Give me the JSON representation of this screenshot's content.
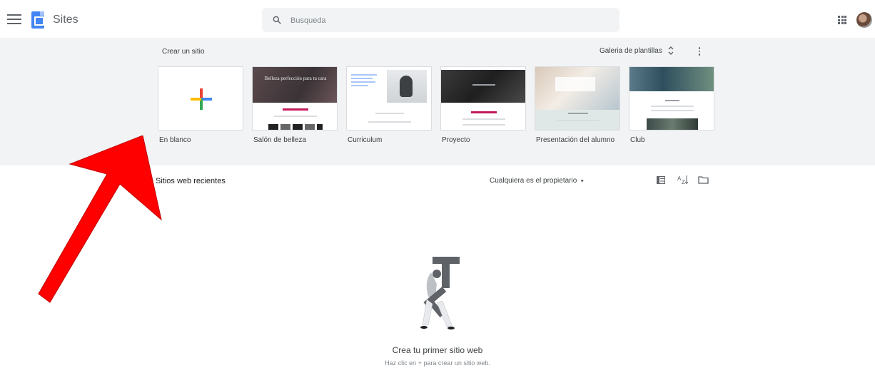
{
  "app": {
    "title": "Sites"
  },
  "search": {
    "placeholder": "Busqueda"
  },
  "gallery": {
    "title": "Crear un sitio",
    "toggle_label": "Galeria de plantillas",
    "templates": [
      {
        "label": "En blanco"
      },
      {
        "label": "Salón de belleza",
        "thumb_title": "Belleza perfección para tu cara"
      },
      {
        "label": "Curriculum"
      },
      {
        "label": "Proyecto"
      },
      {
        "label": "Presentación del alumno"
      },
      {
        "label": "Club"
      }
    ]
  },
  "recent": {
    "title": "Sitios web recientes",
    "owner_filter": "Cualquiera es el propietario",
    "sort_label": "AZ"
  },
  "empty_state": {
    "title": "Crea tu primer sitio web",
    "subtitle": "Haz clic en + para crear un sitio web."
  },
  "colors": {
    "google_blue": "#4285f4",
    "google_red": "#ea4335",
    "google_yellow": "#fbbc04",
    "google_green": "#34a853",
    "gallery_bg": "#f1f3f4",
    "annotation_arrow": "#ff0000"
  },
  "icons": [
    "menu-icon",
    "sites-logo-icon",
    "search-icon",
    "apps-grid-icon",
    "more-vert-icon",
    "unfold-icon",
    "list-view-icon",
    "sort-az-icon",
    "folder-icon",
    "plus-icon"
  ]
}
